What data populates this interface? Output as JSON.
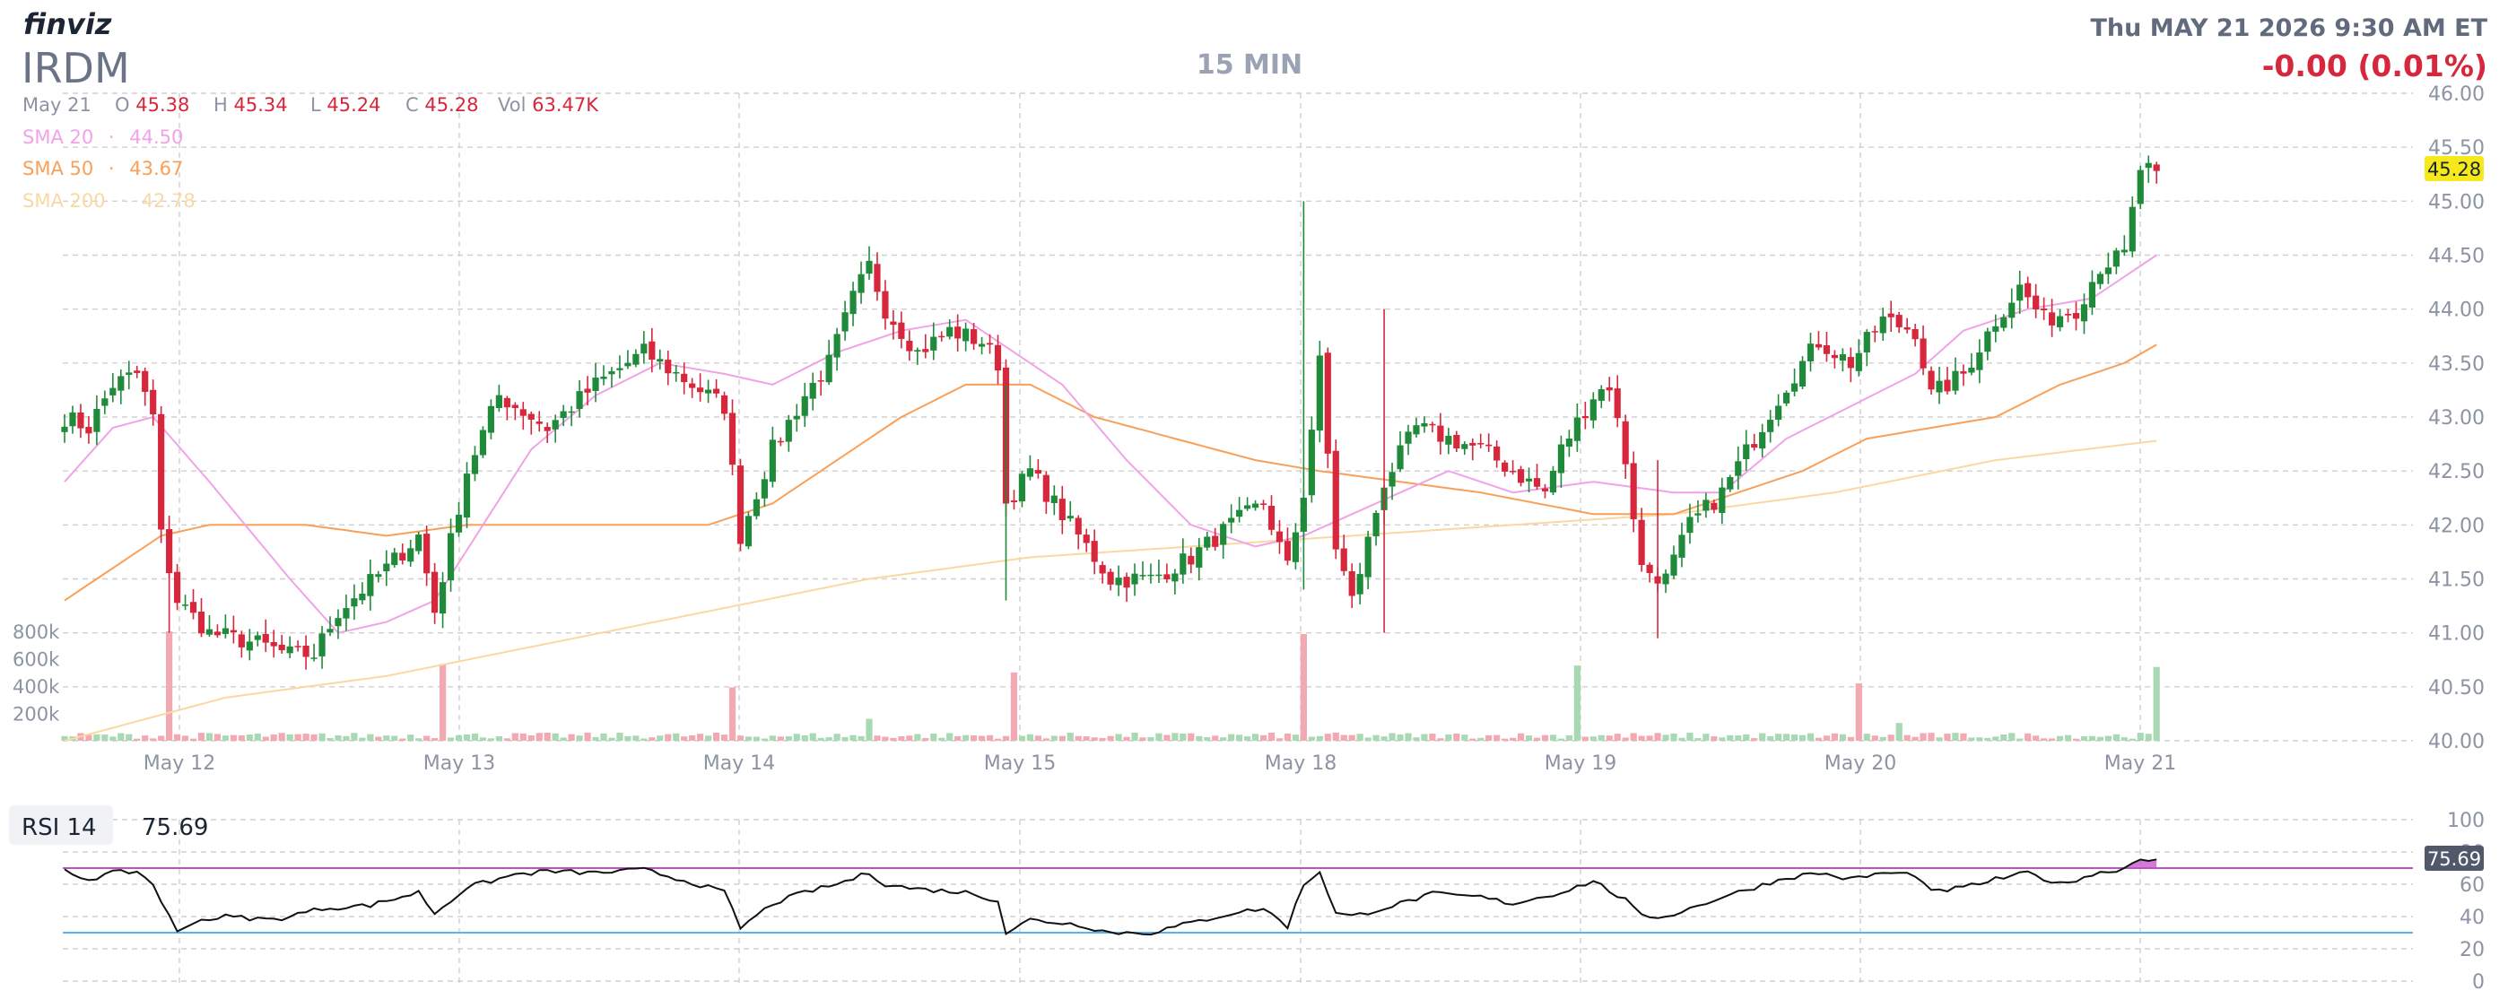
{
  "header": {
    "logo": "finviz",
    "ticker": "IRDM",
    "timeframe": "15 MIN",
    "datetime": "Thu MAY 21 2026 9:30 AM ET",
    "change": "-0.00 (0.01%)"
  },
  "ohlc": {
    "date": "May 21",
    "o_label": "O",
    "o": "45.38",
    "h_label": "H",
    "h": "45.34",
    "l_label": "L",
    "l": "45.24",
    "c_label": "C",
    "c": "45.28",
    "vol_label": "Vol",
    "vol": "63.47K"
  },
  "sma": [
    {
      "label": "SMA 20",
      "value": "44.50",
      "color": "#f0a3e6"
    },
    {
      "label": "SMA 50",
      "value": "43.67",
      "color": "#f9a058"
    },
    {
      "label": "SMA 200",
      "value": "42.78",
      "color": "#f9d8a4"
    }
  ],
  "rsi": {
    "label": "RSI 14",
    "value": "75.69",
    "badge": "75.69",
    "overbought": 70,
    "oversold": 30
  },
  "colors": {
    "up": "#1f8b3a",
    "down": "#d6273c",
    "grid": "#d0d0d0",
    "text": "#8c93a3",
    "price_badge": "#f5e91c",
    "rsi_badge": "#50586a",
    "rsi_line": "#111111",
    "rsi_upper": "#c24fc8",
    "rsi_lower": "#58b3f0",
    "rsi_fill": "#c24fc8",
    "vol_up": "#a8d9b3",
    "vol_down": "#f2a9b1"
  },
  "chart_data": [
    {
      "type": "candlestick",
      "title": "",
      "x_dates": [
        "May 12",
        "May 13",
        "May 14",
        "May 15",
        "May 18",
        "May 19",
        "May 20",
        "May 21"
      ],
      "price_ticks": [
        "46.00",
        "45.50",
        "45.00",
        "44.50",
        "44.00",
        "43.50",
        "43.00",
        "42.50",
        "42.00",
        "41.50",
        "41.00",
        "40.50",
        "40.00"
      ],
      "ylim": [
        40.0,
        46.0
      ],
      "last_price": "45.28",
      "volume_ticks": [
        "800k",
        "600k",
        "400k",
        "200k"
      ],
      "volume_ylim": [
        0,
        800000
      ],
      "anchors": [
        [
          0,
          43.0
        ],
        [
          3,
          42.9
        ],
        [
          6,
          43.3
        ],
        [
          9,
          43.4
        ],
        [
          11,
          43.0
        ],
        [
          12,
          41.9
        ],
        [
          14,
          41.3
        ],
        [
          18,
          41.0
        ],
        [
          24,
          40.9
        ],
        [
          28,
          40.8
        ],
        [
          31,
          40.8
        ],
        [
          34,
          41.2
        ],
        [
          40,
          41.6
        ],
        [
          44,
          41.9
        ],
        [
          46,
          41.2
        ],
        [
          50,
          42.5
        ],
        [
          54,
          43.2
        ],
        [
          60,
          42.9
        ],
        [
          66,
          43.3
        ],
        [
          72,
          43.6
        ],
        [
          78,
          43.3
        ],
        [
          82,
          43.1
        ],
        [
          84,
          41.9
        ],
        [
          88,
          42.7
        ],
        [
          92,
          43.2
        ],
        [
          95,
          43.5
        ],
        [
          98,
          44.1
        ],
        [
          100,
          44.4
        ],
        [
          102,
          44.0
        ],
        [
          106,
          43.6
        ],
        [
          110,
          43.8
        ],
        [
          114,
          43.7
        ],
        [
          116,
          43.5
        ],
        [
          117,
          42.2
        ],
        [
          120,
          42.5
        ],
        [
          126,
          41.9
        ],
        [
          130,
          41.5
        ],
        [
          135,
          41.5
        ],
        [
          140,
          41.7
        ],
        [
          145,
          42.0
        ],
        [
          149,
          42.2
        ],
        [
          152,
          41.6
        ],
        [
          154,
          42.3
        ],
        [
          156,
          43.5
        ],
        [
          158,
          41.8
        ],
        [
          160,
          41.3
        ],
        [
          164,
          42.4
        ],
        [
          168,
          42.9
        ],
        [
          172,
          42.8
        ],
        [
          176,
          42.7
        ],
        [
          180,
          42.5
        ],
        [
          184,
          42.3
        ],
        [
          186,
          42.7
        ],
        [
          190,
          43.2
        ],
        [
          192,
          43.3
        ],
        [
          194,
          42.6
        ],
        [
          196,
          41.6
        ],
        [
          199,
          41.5
        ],
        [
          202,
          42.0
        ],
        [
          206,
          42.3
        ],
        [
          210,
          42.8
        ],
        [
          214,
          43.3
        ],
        [
          218,
          43.7
        ],
        [
          222,
          43.5
        ],
        [
          226,
          43.9
        ],
        [
          230,
          43.8
        ],
        [
          232,
          43.2
        ],
        [
          236,
          43.4
        ],
        [
          240,
          43.9
        ],
        [
          243,
          44.2
        ],
        [
          246,
          43.9
        ],
        [
          250,
          44.0
        ],
        [
          253,
          44.4
        ],
        [
          256,
          44.5
        ],
        [
          258,
          45.3
        ],
        [
          260,
          45.28
        ]
      ],
      "sma20": [
        [
          0,
          42.4
        ],
        [
          6,
          42.9
        ],
        [
          11,
          43.0
        ],
        [
          18,
          42.4
        ],
        [
          28,
          41.5
        ],
        [
          34,
          41.0
        ],
        [
          40,
          41.1
        ],
        [
          46,
          41.3
        ],
        [
          52,
          42.0
        ],
        [
          58,
          42.7
        ],
        [
          66,
          43.2
        ],
        [
          74,
          43.5
        ],
        [
          82,
          43.4
        ],
        [
          88,
          43.3
        ],
        [
          96,
          43.6
        ],
        [
          104,
          43.8
        ],
        [
          112,
          43.9
        ],
        [
          116,
          43.7
        ],
        [
          124,
          43.3
        ],
        [
          132,
          42.6
        ],
        [
          140,
          42.0
        ],
        [
          148,
          41.8
        ],
        [
          154,
          41.9
        ],
        [
          160,
          42.1
        ],
        [
          166,
          42.3
        ],
        [
          172,
          42.5
        ],
        [
          180,
          42.3
        ],
        [
          190,
          42.4
        ],
        [
          200,
          42.3
        ],
        [
          206,
          42.3
        ],
        [
          214,
          42.8
        ],
        [
          222,
          43.1
        ],
        [
          230,
          43.4
        ],
        [
          236,
          43.8
        ],
        [
          244,
          44.0
        ],
        [
          252,
          44.1
        ],
        [
          260,
          44.5
        ]
      ],
      "sma50": [
        [
          0,
          41.3
        ],
        [
          6,
          41.6
        ],
        [
          12,
          41.9
        ],
        [
          18,
          42.0
        ],
        [
          30,
          42.0
        ],
        [
          40,
          41.9
        ],
        [
          50,
          42.0
        ],
        [
          66,
          42.0
        ],
        [
          80,
          42.0
        ],
        [
          88,
          42.2
        ],
        [
          96,
          42.6
        ],
        [
          104,
          43.0
        ],
        [
          112,
          43.3
        ],
        [
          120,
          43.3
        ],
        [
          128,
          43.0
        ],
        [
          138,
          42.8
        ],
        [
          148,
          42.6
        ],
        [
          156,
          42.5
        ],
        [
          166,
          42.4
        ],
        [
          176,
          42.3
        ],
        [
          190,
          42.1
        ],
        [
          200,
          42.1
        ],
        [
          208,
          42.3
        ],
        [
          216,
          42.5
        ],
        [
          224,
          42.8
        ],
        [
          232,
          42.9
        ],
        [
          240,
          43.0
        ],
        [
          248,
          43.3
        ],
        [
          256,
          43.5
        ],
        [
          260,
          43.67
        ]
      ],
      "sma200": [
        [
          0,
          40.0
        ],
        [
          20,
          40.4
        ],
        [
          40,
          40.6
        ],
        [
          60,
          40.9
        ],
        [
          80,
          41.2
        ],
        [
          100,
          41.5
        ],
        [
          120,
          41.7
        ],
        [
          140,
          41.8
        ],
        [
          160,
          41.9
        ],
        [
          180,
          42.0
        ],
        [
          200,
          42.1
        ],
        [
          220,
          42.3
        ],
        [
          240,
          42.6
        ],
        [
          260,
          42.78
        ]
      ],
      "volume_spikes": [
        [
          13,
          800000,
          "down"
        ],
        [
          47,
          560000,
          "down"
        ],
        [
          83,
          390000,
          "down"
        ],
        [
          100,
          160000,
          "up"
        ],
        [
          118,
          500000,
          "down"
        ],
        [
          154,
          780000,
          "down"
        ],
        [
          188,
          550000,
          "up"
        ],
        [
          223,
          420000,
          "down"
        ],
        [
          228,
          130000,
          "up"
        ],
        [
          260,
          540000,
          "up"
        ]
      ]
    },
    {
      "type": "line",
      "title": "RSI 14",
      "yticks": [
        "100",
        "80",
        "60",
        "40",
        "20",
        "0"
      ],
      "ylim": [
        0,
        100
      ],
      "series": [
        {
          "name": "RSI 14",
          "points": [
            [
              0,
              68
            ],
            [
              3,
              63
            ],
            [
              6,
              67
            ],
            [
              9,
              68
            ],
            [
              11,
              60
            ],
            [
              12,
              50
            ],
            [
              14,
              30
            ],
            [
              16,
              37
            ],
            [
              20,
              40
            ],
            [
              26,
              38
            ],
            [
              32,
              45
            ],
            [
              38,
              47
            ],
            [
              44,
              55
            ],
            [
              46,
              42
            ],
            [
              50,
              58
            ],
            [
              56,
              66
            ],
            [
              60,
              68
            ],
            [
              66,
              67
            ],
            [
              72,
              69
            ],
            [
              78,
              61
            ],
            [
              82,
              55
            ],
            [
              84,
              33
            ],
            [
              88,
              48
            ],
            [
              92,
              55
            ],
            [
              96,
              60
            ],
            [
              100,
              67
            ],
            [
              102,
              60
            ],
            [
              106,
              57
            ],
            [
              112,
              55
            ],
            [
              116,
              50
            ],
            [
              117,
              30
            ],
            [
              120,
              38
            ],
            [
              126,
              35
            ],
            [
              130,
              30
            ],
            [
              135,
              30
            ],
            [
              140,
              36
            ],
            [
              145,
              42
            ],
            [
              149,
              45
            ],
            [
              152,
              34
            ],
            [
              154,
              60
            ],
            [
              156,
              68
            ],
            [
              158,
              42
            ],
            [
              160,
              40
            ],
            [
              166,
              48
            ],
            [
              170,
              54
            ],
            [
              176,
              52
            ],
            [
              180,
              48
            ],
            [
              186,
              55
            ],
            [
              190,
              62
            ],
            [
              194,
              50
            ],
            [
              196,
              40
            ],
            [
              199,
              40
            ],
            [
              202,
              45
            ],
            [
              206,
              52
            ],
            [
              210,
              58
            ],
            [
              214,
              64
            ],
            [
              218,
              67
            ],
            [
              222,
              63
            ],
            [
              226,
              67
            ],
            [
              230,
              66
            ],
            [
              232,
              55
            ],
            [
              236,
              58
            ],
            [
              240,
              63
            ],
            [
              244,
              67
            ],
            [
              248,
              60
            ],
            [
              252,
              66
            ],
            [
              256,
              70
            ],
            [
              258,
              76
            ],
            [
              260,
              75.7
            ]
          ]
        }
      ]
    }
  ]
}
